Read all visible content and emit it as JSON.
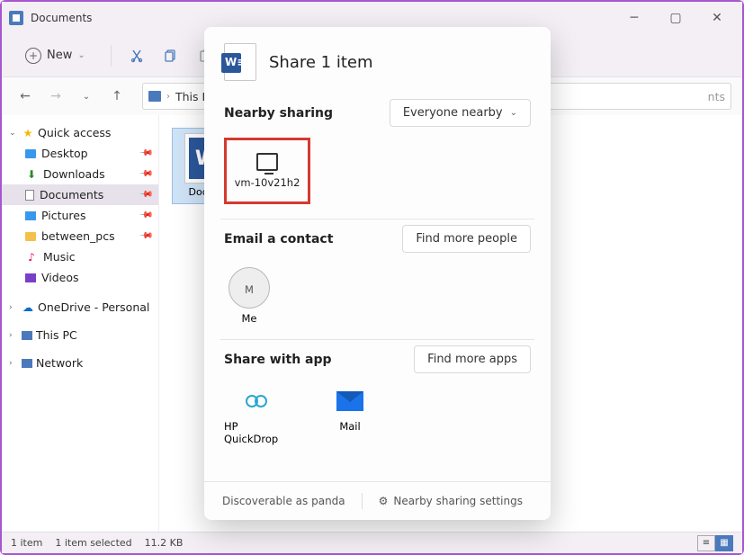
{
  "window": {
    "title": "Documents"
  },
  "toolbar": {
    "new_label": "New"
  },
  "addressbar": {
    "root": "This PC",
    "tail": "nts"
  },
  "sidebar": {
    "quick_access": "Quick access",
    "items": [
      {
        "label": "Desktop"
      },
      {
        "label": "Downloads"
      },
      {
        "label": "Documents"
      },
      {
        "label": "Pictures"
      },
      {
        "label": "between_pcs"
      },
      {
        "label": "Music"
      },
      {
        "label": "Videos"
      }
    ],
    "onedrive": "OneDrive - Personal",
    "this_pc": "This PC",
    "network": "Network"
  },
  "content": {
    "file_label": "Docum"
  },
  "statusbar": {
    "count": "1 item",
    "selected": "1 item selected",
    "size": "11.2 KB"
  },
  "share": {
    "title": "Share 1 item",
    "nearby_label": "Nearby sharing",
    "nearby_scope": "Everyone nearby",
    "device_name": "vm-10v21h2",
    "email_label": "Email a contact",
    "find_people": "Find more people",
    "contact_initial": "M",
    "contact_name": "Me",
    "app_label": "Share with app",
    "find_apps": "Find more apps",
    "app1": "HP QuickDrop",
    "app2": "Mail",
    "discoverable": "Discoverable as panda",
    "settings": "Nearby sharing settings"
  }
}
